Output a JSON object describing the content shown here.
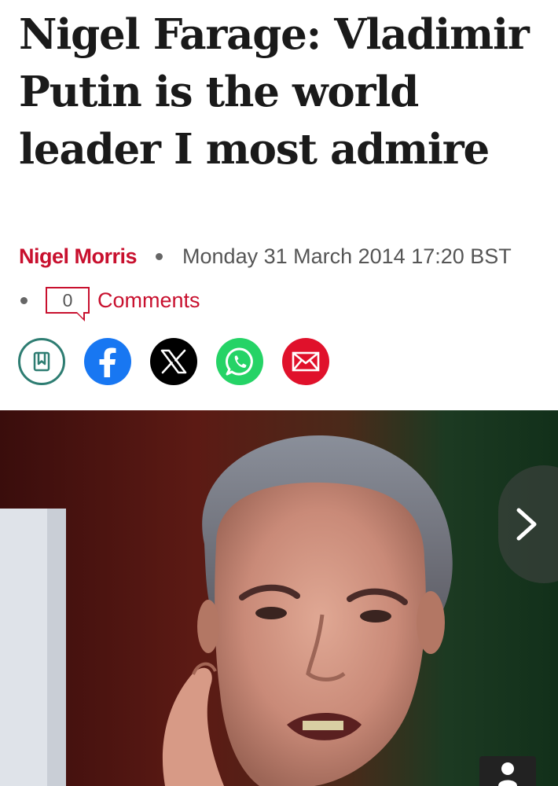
{
  "article": {
    "headline": "Nigel Farage: Vladimir Putin is the world leader I most admire",
    "author": "Nigel Morris",
    "date": "Monday 31 March 2014 17:20 BST",
    "comments_count": "0",
    "comments_label": "Comments"
  },
  "share": {
    "buttons": [
      {
        "icon": "bookmark-icon",
        "color": "#2e7d72"
      },
      {
        "icon": "facebook-icon",
        "color": "#1877f2"
      },
      {
        "icon": "x-icon",
        "color": "#000000"
      },
      {
        "icon": "whatsapp-icon",
        "color": "#25d366"
      },
      {
        "icon": "email-icon",
        "color": "#e0112b"
      }
    ]
  },
  "gallery": {
    "next_icon": "chevron-right-icon"
  },
  "colors": {
    "accent": "#c8102e",
    "text": "#1a1a1a",
    "meta": "#555555"
  }
}
